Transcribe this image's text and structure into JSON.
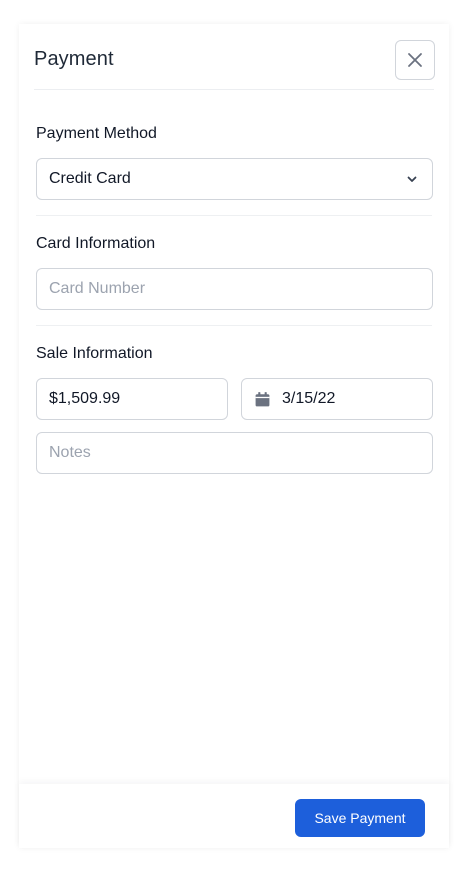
{
  "header": {
    "title": "Payment",
    "close_icon": "close-icon"
  },
  "payment_method": {
    "label": "Payment Method",
    "selected": "Credit Card",
    "chevron_icon": "chevron-down-icon"
  },
  "card_info": {
    "label": "Card Information",
    "card_number_placeholder": "Card Number",
    "card_number_value": ""
  },
  "sale_info": {
    "label": "Sale Information",
    "amount": "$1,509.99",
    "date": "3/15/22",
    "date_icon": "calendar-icon",
    "notes_placeholder": "Notes",
    "notes_value": ""
  },
  "footer": {
    "save_label": "Save Payment"
  },
  "colors": {
    "primary": "#1d5fdb",
    "border": "#d1d5db",
    "placeholder": "#9ca3af"
  }
}
